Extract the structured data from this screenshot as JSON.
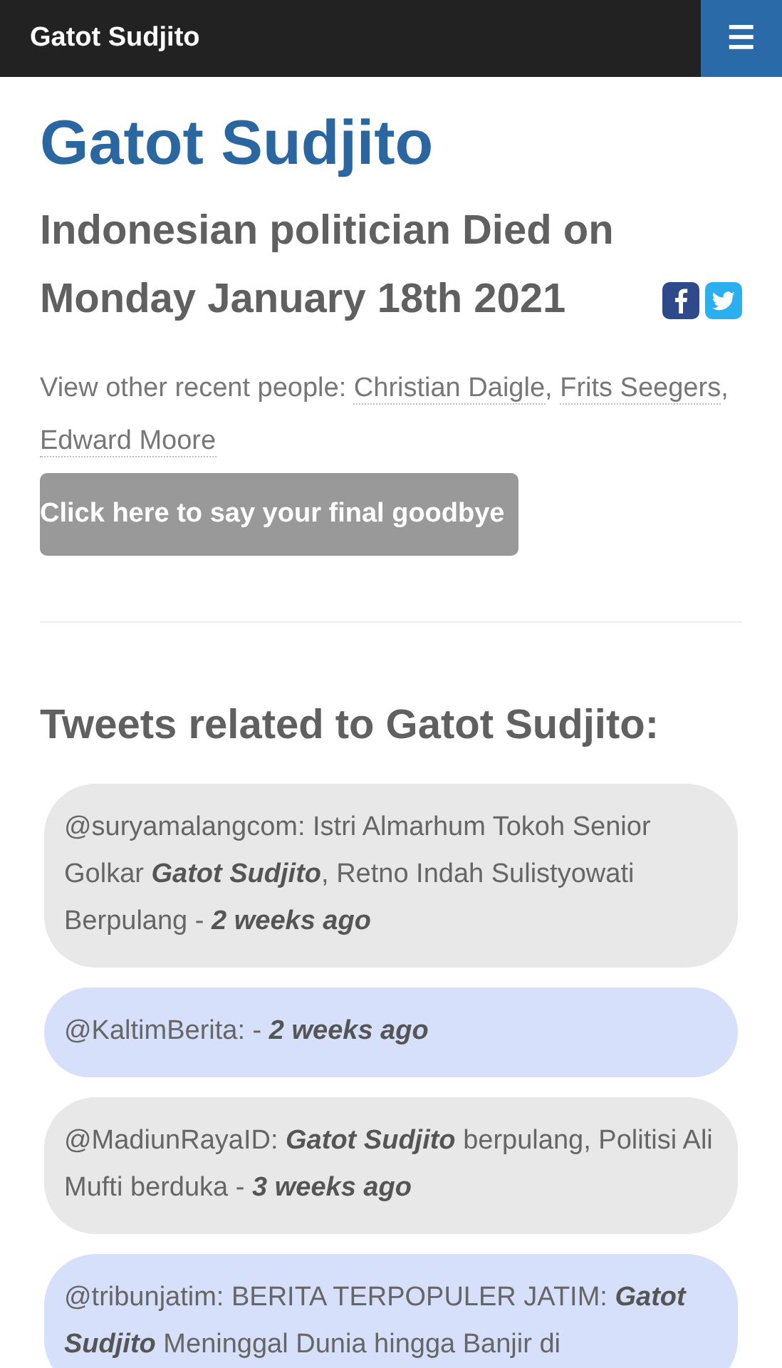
{
  "navbar": {
    "brand": "Gatot Sudjito",
    "menu_icon": "☰"
  },
  "title": "Gatot Sudjito",
  "subtitle": "Indonesian politician Died on Monday January 18th 2021",
  "recent": {
    "label": "View other recent people:",
    "people": [
      {
        "name": "Christian Daigle",
        "separator": ","
      },
      {
        "name": "Frits Seegers",
        "separator": ","
      },
      {
        "name": "Edward Moore"
      }
    ]
  },
  "goodbye_button": "Click here to say your final goodbye",
  "tweets_heading": "Tweets related to Gatot Sudjito:",
  "tweets": [
    {
      "text": "@suryamalangcom: Istri Almarhum Tokoh Senior Golkar **Gatot Sudjito**, Retno Indah Sulistyowati Berpulang - **2 weeks ago**",
      "color": "#e8e8e8"
    },
    {
      "text": "@KaltimBerita: - **2 weeks ago**",
      "color": "#d7e0fb"
    },
    {
      "text": "@MadiunRayaID: **Gatot Sudjito** berpulang, Politisi Ali Mufti berduka - **3 weeks ago**",
      "color": "#e8e8e8"
    },
    {
      "text": "@tribunjatim: BERITA TERPOPULER JATIM: **Gatot Sudjito** Meninggal Dunia hingga Banjir di",
      "color": "#d7e0fb"
    }
  ]
}
